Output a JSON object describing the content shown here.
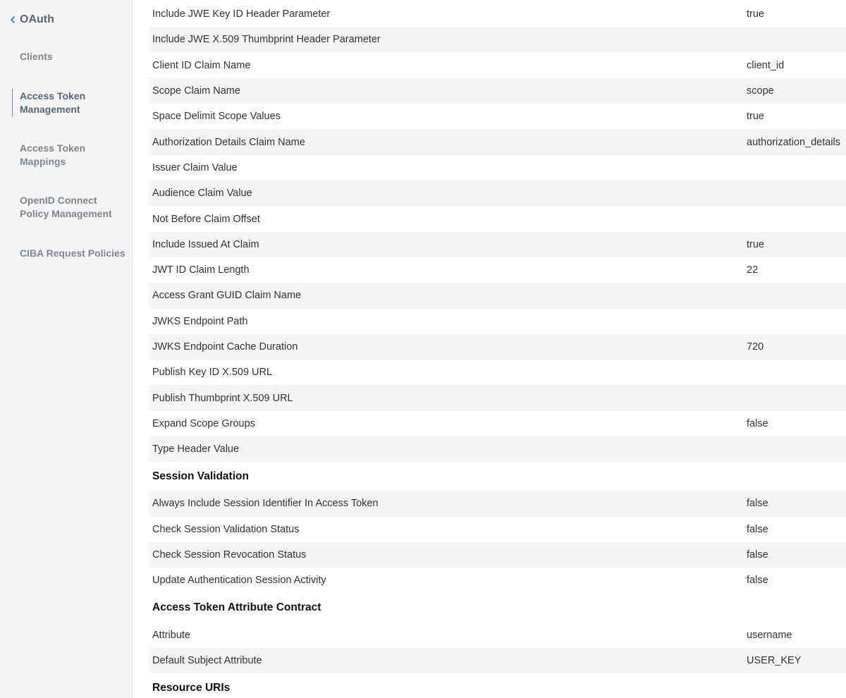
{
  "sidebar": {
    "back_title": "OAuth",
    "items": [
      {
        "label": "Clients"
      },
      {
        "label": "Access Token Management"
      },
      {
        "label": "Access Token Mappings"
      },
      {
        "label": "OpenID Connect Policy Management"
      },
      {
        "label": "CIBA Request Policies"
      }
    ],
    "active_index": 1
  },
  "settings": {
    "rows": [
      {
        "label": "Include JWE Key ID Header Parameter",
        "value": "true"
      },
      {
        "label": "Include JWE X.509 Thumbprint Header Parameter",
        "value": ""
      },
      {
        "label": "Client ID Claim Name",
        "value": "client_id"
      },
      {
        "label": "Scope Claim Name",
        "value": "scope"
      },
      {
        "label": "Space Delimit Scope Values",
        "value": "true"
      },
      {
        "label": "Authorization Details Claim Name",
        "value": "authorization_details"
      },
      {
        "label": "Issuer Claim Value",
        "value": ""
      },
      {
        "label": "Audience Claim Value",
        "value": ""
      },
      {
        "label": "Not Before Claim Offset",
        "value": ""
      },
      {
        "label": "Include Issued At Claim",
        "value": "true"
      },
      {
        "label": "JWT ID Claim Length",
        "value": "22"
      },
      {
        "label": "Access Grant GUID Claim Name",
        "value": ""
      },
      {
        "label": "JWKS Endpoint Path",
        "value": ""
      },
      {
        "label": "JWKS Endpoint Cache Duration",
        "value": "720"
      },
      {
        "label": "Publish Key ID X.509 URL",
        "value": ""
      },
      {
        "label": "Publish Thumbprint X.509 URL",
        "value": ""
      },
      {
        "label": "Expand Scope Groups",
        "value": "false"
      },
      {
        "label": "Type Header Value",
        "value": ""
      }
    ]
  },
  "session_validation": {
    "title": "Session Validation",
    "rows": [
      {
        "label": "Always Include Session Identifier In Access Token",
        "value": "false"
      },
      {
        "label": "Check Session Validation Status",
        "value": "false"
      },
      {
        "label": "Check Session Revocation Status",
        "value": "false"
      },
      {
        "label": "Update Authentication Session Activity",
        "value": "false"
      }
    ]
  },
  "attribute_contract": {
    "title": "Access Token Attribute Contract",
    "rows": [
      {
        "label": "Attribute",
        "value": "username"
      },
      {
        "label": "Default Subject Attribute",
        "value": "USER_KEY"
      }
    ]
  },
  "resource_uris": {
    "title": "Resource URIs"
  }
}
